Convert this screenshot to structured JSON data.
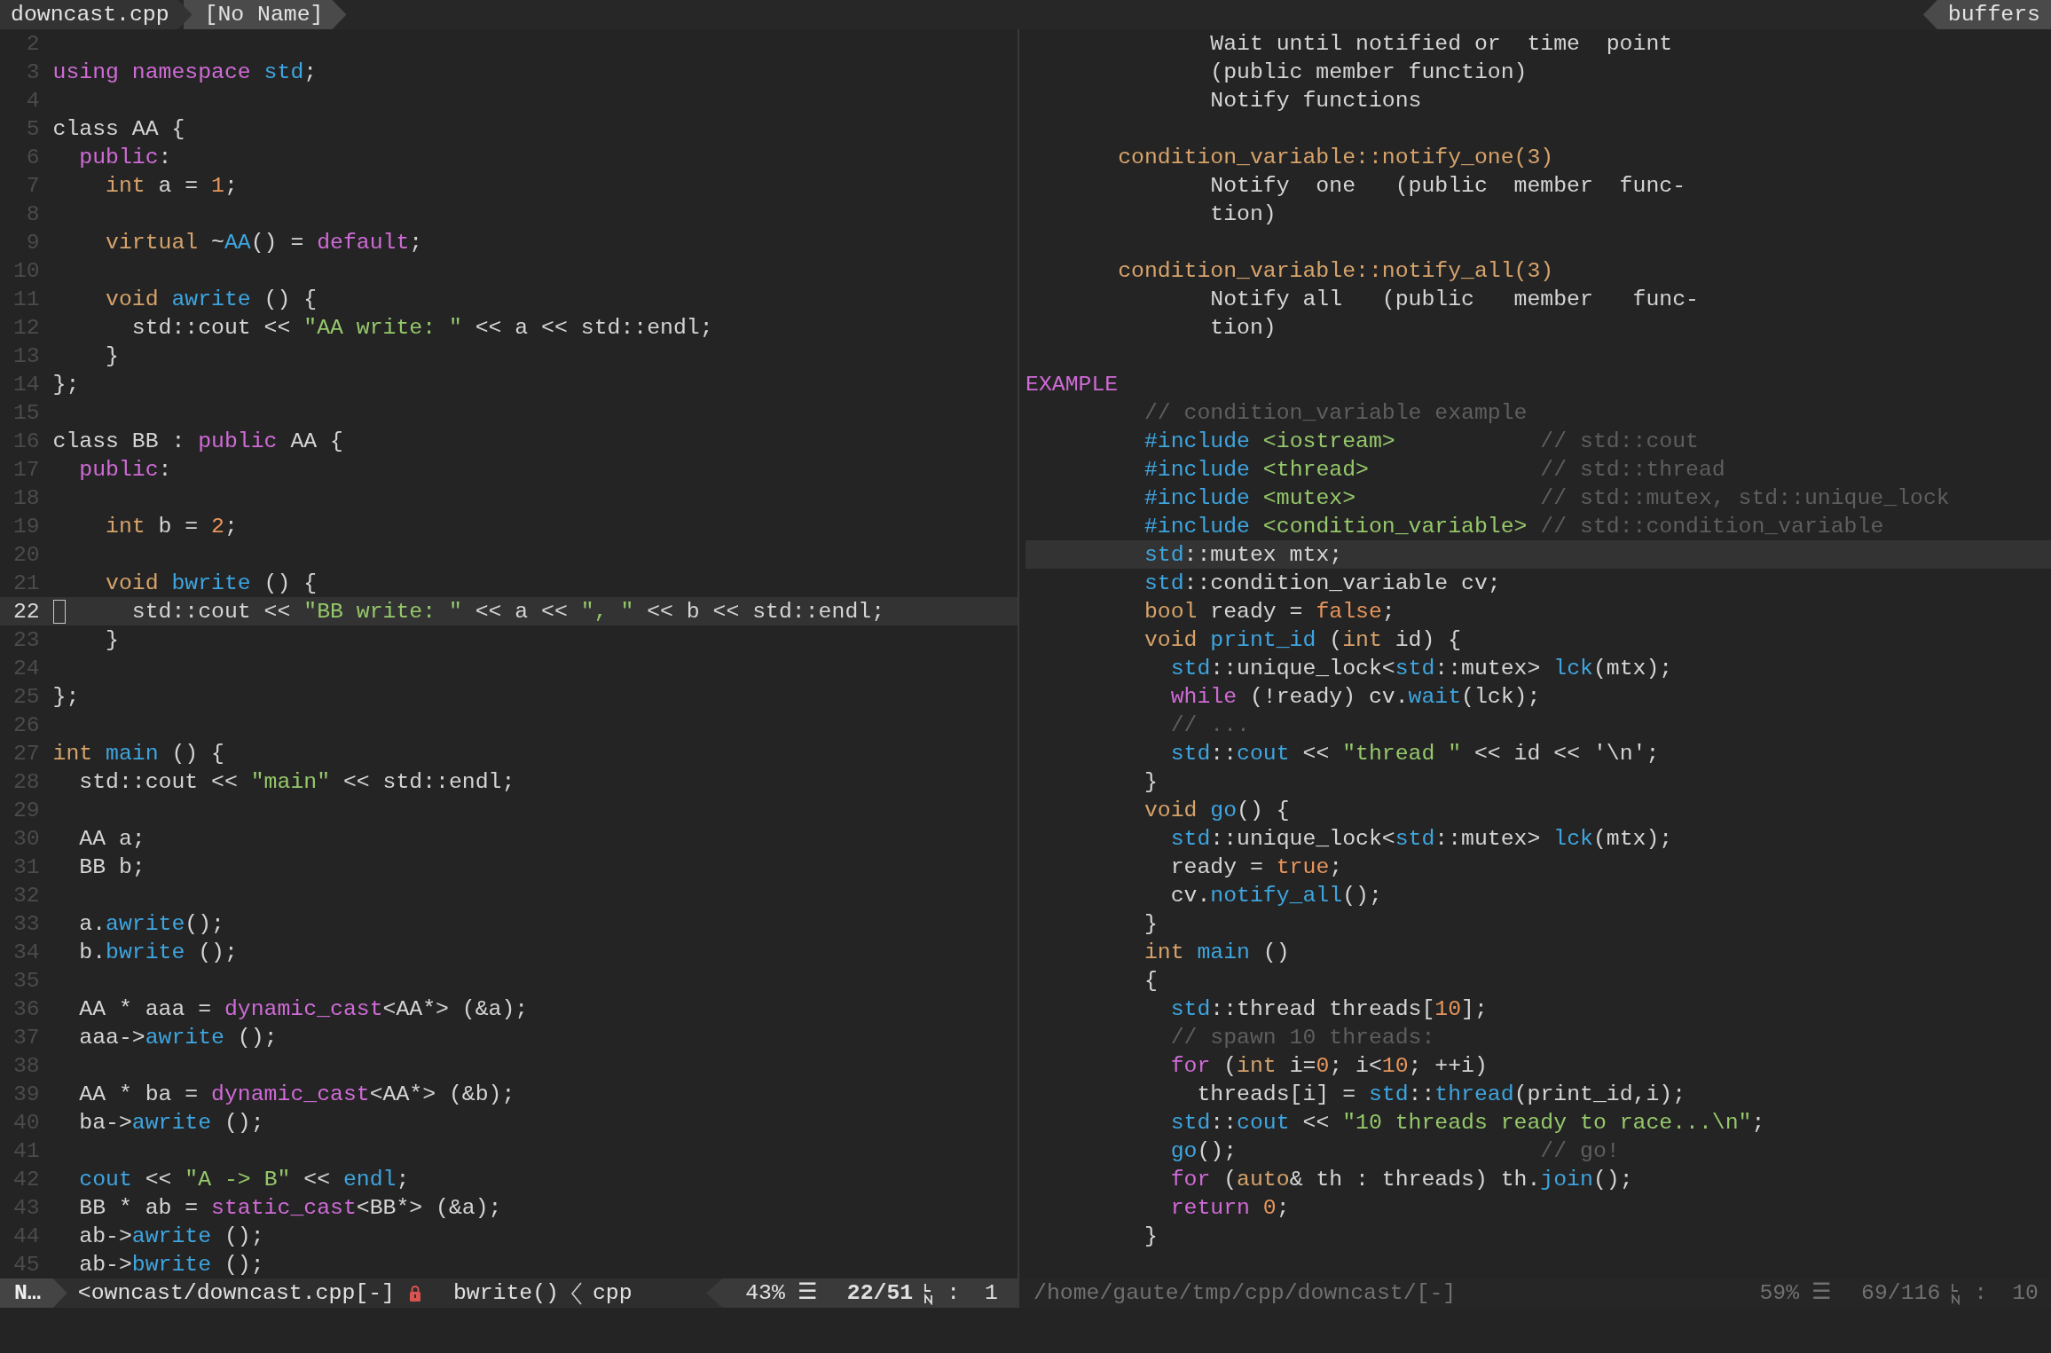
{
  "tabline": {
    "tabs": [
      {
        "label": "downcast.cpp",
        "selected": true
      },
      {
        "label": "[No Name]",
        "selected": false
      }
    ],
    "buffers_label": "buffers"
  },
  "left_window": {
    "active": true,
    "lines": [
      {
        "number": "2",
        "current": false
      },
      {
        "number": "3",
        "current": false,
        "segments": [
          {
            "text": "using namespace",
            "kind": "keyword"
          },
          {
            "text": " std",
            "kind": "function"
          },
          {
            "text": ";",
            "kind": "plain"
          }
        ]
      },
      {
        "number": "4",
        "current": false
      },
      {
        "number": "5",
        "current": false,
        "segments": [
          {
            "text": "class AA {",
            "kind": "plain"
          }
        ]
      },
      {
        "number": "6",
        "current": false,
        "segments": [
          {
            "text": "  public",
            "kind": "keyword"
          },
          {
            "text": ":",
            "kind": "plain"
          }
        ]
      },
      {
        "number": "7",
        "current": false,
        "segments": [
          {
            "text": "    int",
            "kind": "type"
          },
          {
            "text": " a = ",
            "kind": "plain"
          },
          {
            "text": "1",
            "kind": "number"
          },
          {
            "text": ";",
            "kind": "plain"
          }
        ]
      },
      {
        "number": "8",
        "current": false
      },
      {
        "number": "9",
        "current": false,
        "segments": [
          {
            "text": "    virtual",
            "kind": "type"
          },
          {
            "text": " ~",
            "kind": "plain"
          },
          {
            "text": "AA",
            "kind": "function"
          },
          {
            "text": "() = ",
            "kind": "plain"
          },
          {
            "text": "default",
            "kind": "keyword"
          },
          {
            "text": ";",
            "kind": "plain"
          }
        ]
      },
      {
        "number": "10",
        "current": false
      },
      {
        "number": "11",
        "current": false,
        "segments": [
          {
            "text": "    void",
            "kind": "type"
          },
          {
            "text": " awrite",
            "kind": "function"
          },
          {
            "text": " () {",
            "kind": "plain"
          }
        ]
      },
      {
        "number": "12",
        "current": false,
        "segments": [
          {
            "text": "      std::cout << ",
            "kind": "plain"
          },
          {
            "text": "\"AA write: \"",
            "kind": "string"
          },
          {
            "text": " << a << std::endl;",
            "kind": "plain"
          }
        ]
      },
      {
        "number": "13",
        "current": false,
        "segments": [
          {
            "text": "    }",
            "kind": "plain"
          }
        ]
      },
      {
        "number": "14",
        "current": false,
        "segments": [
          {
            "text": "};",
            "kind": "plain"
          }
        ]
      },
      {
        "number": "15",
        "current": false
      },
      {
        "number": "16",
        "current": false,
        "segments": [
          {
            "text": "class BB : ",
            "kind": "plain"
          },
          {
            "text": "public",
            "kind": "keyword"
          },
          {
            "text": " AA {",
            "kind": "plain"
          }
        ]
      },
      {
        "number": "17",
        "current": false,
        "segments": [
          {
            "text": "  public",
            "kind": "keyword"
          },
          {
            "text": ":",
            "kind": "plain"
          }
        ]
      },
      {
        "number": "18",
        "current": false
      },
      {
        "number": "19",
        "current": false,
        "segments": [
          {
            "text": "    int",
            "kind": "type"
          },
          {
            "text": " b = ",
            "kind": "plain"
          },
          {
            "text": "2",
            "kind": "number"
          },
          {
            "text": ";",
            "kind": "plain"
          }
        ]
      },
      {
        "number": "20",
        "current": false
      },
      {
        "number": "21",
        "current": false,
        "segments": [
          {
            "text": "    void",
            "kind": "type"
          },
          {
            "text": " bwrite",
            "kind": "function"
          },
          {
            "text": " () {",
            "kind": "plain"
          }
        ]
      },
      {
        "number": "22",
        "current": true,
        "segments": [
          {
            "text": "      std::cout << ",
            "kind": "plain"
          },
          {
            "text": "\"BB write: \"",
            "kind": "string"
          },
          {
            "text": " << a << ",
            "kind": "plain"
          },
          {
            "text": "\", \"",
            "kind": "string"
          },
          {
            "text": " << b << std::endl;",
            "kind": "plain"
          }
        ]
      },
      {
        "number": "23",
        "current": false,
        "segments": [
          {
            "text": "    }",
            "kind": "plain"
          }
        ]
      },
      {
        "number": "24",
        "current": false
      },
      {
        "number": "25",
        "current": false,
        "segments": [
          {
            "text": "};",
            "kind": "plain"
          }
        ]
      },
      {
        "number": "26",
        "current": false
      },
      {
        "number": "27",
        "current": false,
        "segments": [
          {
            "text": "int",
            "kind": "type"
          },
          {
            "text": " main",
            "kind": "function"
          },
          {
            "text": " () {",
            "kind": "plain"
          }
        ]
      },
      {
        "number": "28",
        "current": false,
        "segments": [
          {
            "text": "  std::cout << ",
            "kind": "plain"
          },
          {
            "text": "\"main\"",
            "kind": "string"
          },
          {
            "text": " << std::endl;",
            "kind": "plain"
          }
        ]
      },
      {
        "number": "29",
        "current": false
      },
      {
        "number": "30",
        "current": false,
        "segments": [
          {
            "text": "  AA a;",
            "kind": "plain"
          }
        ]
      },
      {
        "number": "31",
        "current": false,
        "segments": [
          {
            "text": "  BB b;",
            "kind": "plain"
          }
        ]
      },
      {
        "number": "32",
        "current": false
      },
      {
        "number": "33",
        "current": false,
        "segments": [
          {
            "text": "  a.",
            "kind": "plain"
          },
          {
            "text": "awrite",
            "kind": "function"
          },
          {
            "text": "();",
            "kind": "plain"
          }
        ]
      },
      {
        "number": "34",
        "current": false,
        "segments": [
          {
            "text": "  b.",
            "kind": "plain"
          },
          {
            "text": "bwrite",
            "kind": "function"
          },
          {
            "text": " ();",
            "kind": "plain"
          }
        ]
      },
      {
        "number": "35",
        "current": false
      },
      {
        "number": "36",
        "current": false,
        "segments": [
          {
            "text": "  AA * aaa = ",
            "kind": "plain"
          },
          {
            "text": "dynamic_cast",
            "kind": "keyword"
          },
          {
            "text": "<AA*> (&a);",
            "kind": "plain"
          }
        ]
      },
      {
        "number": "37",
        "current": false,
        "segments": [
          {
            "text": "  aaa->",
            "kind": "plain"
          },
          {
            "text": "awrite",
            "kind": "function"
          },
          {
            "text": " ();",
            "kind": "plain"
          }
        ]
      },
      {
        "number": "38",
        "current": false
      },
      {
        "number": "39",
        "current": false,
        "segments": [
          {
            "text": "  AA * ba = ",
            "kind": "plain"
          },
          {
            "text": "dynamic_cast",
            "kind": "keyword"
          },
          {
            "text": "<AA*> (&b);",
            "kind": "plain"
          }
        ]
      },
      {
        "number": "40",
        "current": false,
        "segments": [
          {
            "text": "  ba->",
            "kind": "plain"
          },
          {
            "text": "awrite",
            "kind": "function"
          },
          {
            "text": " ();",
            "kind": "plain"
          }
        ]
      },
      {
        "number": "41",
        "current": false
      },
      {
        "number": "42",
        "current": false,
        "segments": [
          {
            "text": "  cout",
            "kind": "function"
          },
          {
            "text": " << ",
            "kind": "plain"
          },
          {
            "text": "\"A -> B\"",
            "kind": "string"
          },
          {
            "text": " << ",
            "kind": "plain"
          },
          {
            "text": "endl",
            "kind": "function"
          },
          {
            "text": ";",
            "kind": "plain"
          }
        ]
      },
      {
        "number": "43",
        "current": false,
        "segments": [
          {
            "text": "  BB * ab = ",
            "kind": "plain"
          },
          {
            "text": "static_cast",
            "kind": "keyword"
          },
          {
            "text": "<BB*> (&a);",
            "kind": "plain"
          }
        ]
      },
      {
        "number": "44",
        "current": false,
        "segments": [
          {
            "text": "  ab->",
            "kind": "plain"
          },
          {
            "text": "awrite",
            "kind": "function"
          },
          {
            "text": " ();",
            "kind": "plain"
          }
        ]
      },
      {
        "number": "45",
        "current": false,
        "segments": [
          {
            "text": "  ab->",
            "kind": "plain"
          },
          {
            "text": "bwrite",
            "kind": "function"
          },
          {
            "text": " ();",
            "kind": "plain"
          }
        ]
      }
    ],
    "status": {
      "mode": "N…",
      "file": "<owncast/downcast.cpp[-]",
      "readonly": true,
      "function": "bwrite()",
      "filetype": "cpp",
      "percent": "43%",
      "glyph": "☰",
      "position": "22/51",
      "separator": ":",
      "column": "1"
    }
  },
  "right_window": {
    "active": false,
    "lines": [
      {
        "current": false,
        "segments": [
          {
            "text": "              Wait until notified or  time  point",
            "kind": "plain"
          }
        ]
      },
      {
        "current": false,
        "segments": [
          {
            "text": "              (public member function)",
            "kind": "plain"
          }
        ]
      },
      {
        "current": false,
        "segments": [
          {
            "text": "              Notify functions",
            "kind": "plain"
          }
        ]
      },
      {
        "current": false
      },
      {
        "current": false,
        "segments": [
          {
            "text": "       condition_variable::notify_one(3)",
            "kind": "type"
          }
        ]
      },
      {
        "current": false,
        "segments": [
          {
            "text": "              Notify  one   (public  member  func-",
            "kind": "plain"
          }
        ]
      },
      {
        "current": false,
        "segments": [
          {
            "text": "              tion)",
            "kind": "plain"
          }
        ]
      },
      {
        "current": false
      },
      {
        "current": false,
        "segments": [
          {
            "text": "       condition_variable::notify_all(3)",
            "kind": "type"
          }
        ]
      },
      {
        "current": false,
        "segments": [
          {
            "text": "              Notify all   (public   member   func-",
            "kind": "plain"
          }
        ]
      },
      {
        "current": false,
        "segments": [
          {
            "text": "              tion)",
            "kind": "plain"
          }
        ]
      },
      {
        "current": false
      },
      {
        "current": false,
        "segments": [
          {
            "text": "EXAMPLE",
            "kind": "keyword"
          }
        ]
      },
      {
        "current": false,
        "segments": [
          {
            "text": "         // condition_variable example",
            "kind": "comment"
          }
        ]
      },
      {
        "current": false,
        "segments": [
          {
            "text": "         #include",
            "kind": "function"
          },
          {
            "text": " <iostream>",
            "kind": "string"
          },
          {
            "text": "           // std::cout",
            "kind": "comment"
          }
        ]
      },
      {
        "current": false,
        "segments": [
          {
            "text": "         #include",
            "kind": "function"
          },
          {
            "text": " <thread>",
            "kind": "string"
          },
          {
            "text": "             // std::thread",
            "kind": "comment"
          }
        ]
      },
      {
        "current": false,
        "segments": [
          {
            "text": "         #include",
            "kind": "function"
          },
          {
            "text": " <mutex>",
            "kind": "string"
          },
          {
            "text": "              // std::mutex, std::unique_lock",
            "kind": "comment"
          }
        ]
      },
      {
        "current": false,
        "segments": [
          {
            "text": "         #include",
            "kind": "function"
          },
          {
            "text": " <condition_variable>",
            "kind": "string"
          },
          {
            "text": " // std::condition_variable",
            "kind": "comment"
          }
        ]
      },
      {
        "current": true,
        "segments": [
          {
            "text": "         std",
            "kind": "function"
          },
          {
            "text": "::mutex mtx;",
            "kind": "plain"
          }
        ]
      },
      {
        "current": false,
        "segments": [
          {
            "text": "         std",
            "kind": "function"
          },
          {
            "text": "::condition_variable cv;",
            "kind": "plain"
          }
        ]
      },
      {
        "current": false,
        "segments": [
          {
            "text": "         bool",
            "kind": "type"
          },
          {
            "text": " ready = ",
            "kind": "plain"
          },
          {
            "text": "false",
            "kind": "number"
          },
          {
            "text": ";",
            "kind": "plain"
          }
        ]
      },
      {
        "current": false,
        "segments": [
          {
            "text": "         void",
            "kind": "type"
          },
          {
            "text": " print_id",
            "kind": "function"
          },
          {
            "text": " (",
            "kind": "plain"
          },
          {
            "text": "int",
            "kind": "type"
          },
          {
            "text": " id) {",
            "kind": "plain"
          }
        ]
      },
      {
        "current": false,
        "segments": [
          {
            "text": "           std",
            "kind": "function"
          },
          {
            "text": "::unique_lock<",
            "kind": "plain"
          },
          {
            "text": "std",
            "kind": "function"
          },
          {
            "text": "::mutex> ",
            "kind": "plain"
          },
          {
            "text": "lck",
            "kind": "function"
          },
          {
            "text": "(mtx);",
            "kind": "plain"
          }
        ]
      },
      {
        "current": false,
        "segments": [
          {
            "text": "           while",
            "kind": "keyword"
          },
          {
            "text": " (!ready) cv.",
            "kind": "plain"
          },
          {
            "text": "wait",
            "kind": "function"
          },
          {
            "text": "(lck);",
            "kind": "plain"
          }
        ]
      },
      {
        "current": false,
        "segments": [
          {
            "text": "           // ...",
            "kind": "comment"
          }
        ]
      },
      {
        "current": false,
        "segments": [
          {
            "text": "           std",
            "kind": "function"
          },
          {
            "text": "::",
            "kind": "plain"
          },
          {
            "text": "cout",
            "kind": "function"
          },
          {
            "text": " << ",
            "kind": "plain"
          },
          {
            "text": "\"thread \"",
            "kind": "string"
          },
          {
            "text": " << id << '\\n';",
            "kind": "plain"
          }
        ]
      },
      {
        "current": false,
        "segments": [
          {
            "text": "         }",
            "kind": "plain"
          }
        ]
      },
      {
        "current": false,
        "segments": [
          {
            "text": "         void",
            "kind": "type"
          },
          {
            "text": " go",
            "kind": "function"
          },
          {
            "text": "() {",
            "kind": "plain"
          }
        ]
      },
      {
        "current": false,
        "segments": [
          {
            "text": "           std",
            "kind": "function"
          },
          {
            "text": "::unique_lock<",
            "kind": "plain"
          },
          {
            "text": "std",
            "kind": "function"
          },
          {
            "text": "::mutex> ",
            "kind": "plain"
          },
          {
            "text": "lck",
            "kind": "function"
          },
          {
            "text": "(mtx);",
            "kind": "plain"
          }
        ]
      },
      {
        "current": false,
        "segments": [
          {
            "text": "           ready = ",
            "kind": "plain"
          },
          {
            "text": "true",
            "kind": "number"
          },
          {
            "text": ";",
            "kind": "plain"
          }
        ]
      },
      {
        "current": false,
        "segments": [
          {
            "text": "           cv.",
            "kind": "plain"
          },
          {
            "text": "notify_all",
            "kind": "function"
          },
          {
            "text": "();",
            "kind": "plain"
          }
        ]
      },
      {
        "current": false,
        "segments": [
          {
            "text": "         }",
            "kind": "plain"
          }
        ]
      },
      {
        "current": false,
        "segments": [
          {
            "text": "         int",
            "kind": "type"
          },
          {
            "text": " main",
            "kind": "function"
          },
          {
            "text": " ()",
            "kind": "plain"
          }
        ]
      },
      {
        "current": false,
        "segments": [
          {
            "text": "         {",
            "kind": "plain"
          }
        ]
      },
      {
        "current": false,
        "segments": [
          {
            "text": "           std",
            "kind": "function"
          },
          {
            "text": "::thread threads[",
            "kind": "plain"
          },
          {
            "text": "10",
            "kind": "number"
          },
          {
            "text": "];",
            "kind": "plain"
          }
        ]
      },
      {
        "current": false,
        "segments": [
          {
            "text": "           // spawn 10 threads:",
            "kind": "comment"
          }
        ]
      },
      {
        "current": false,
        "segments": [
          {
            "text": "           for",
            "kind": "keyword"
          },
          {
            "text": " (",
            "kind": "plain"
          },
          {
            "text": "int",
            "kind": "type"
          },
          {
            "text": " i=",
            "kind": "plain"
          },
          {
            "text": "0",
            "kind": "number"
          },
          {
            "text": "; i<",
            "kind": "plain"
          },
          {
            "text": "10",
            "kind": "number"
          },
          {
            "text": "; ++i)",
            "kind": "plain"
          }
        ]
      },
      {
        "current": false,
        "segments": [
          {
            "text": "             threads[i] = ",
            "kind": "plain"
          },
          {
            "text": "std",
            "kind": "function"
          },
          {
            "text": "::",
            "kind": "plain"
          },
          {
            "text": "thread",
            "kind": "function"
          },
          {
            "text": "(print_id,i);",
            "kind": "plain"
          }
        ]
      },
      {
        "current": false,
        "segments": [
          {
            "text": "           std",
            "kind": "function"
          },
          {
            "text": "::",
            "kind": "plain"
          },
          {
            "text": "cout",
            "kind": "function"
          },
          {
            "text": " << ",
            "kind": "plain"
          },
          {
            "text": "\"10 threads ready to race...\\n\"",
            "kind": "string"
          },
          {
            "text": ";",
            "kind": "plain"
          }
        ]
      },
      {
        "current": false,
        "segments": [
          {
            "text": "           go",
            "kind": "function"
          },
          {
            "text": "();                       ",
            "kind": "plain"
          },
          {
            "text": "// go!",
            "kind": "comment"
          }
        ]
      },
      {
        "current": false,
        "segments": [
          {
            "text": "           for",
            "kind": "keyword"
          },
          {
            "text": " (",
            "kind": "plain"
          },
          {
            "text": "auto",
            "kind": "type"
          },
          {
            "text": "& th : threads) th.",
            "kind": "plain"
          },
          {
            "text": "join",
            "kind": "function"
          },
          {
            "text": "();",
            "kind": "plain"
          }
        ]
      },
      {
        "current": false,
        "segments": [
          {
            "text": "           return",
            "kind": "keyword"
          },
          {
            "text": " 0",
            "kind": "number"
          },
          {
            "text": ";",
            "kind": "plain"
          }
        ]
      },
      {
        "current": false,
        "segments": [
          {
            "text": "         }",
            "kind": "plain"
          }
        ]
      },
      {
        "current": false
      }
    ],
    "status": {
      "file": "/home/gaute/tmp/cpp/downcast/[-]",
      "readonly": false,
      "percent": "59%",
      "glyph": "☰",
      "position": "69/116",
      "separator": ":",
      "column": "10"
    }
  }
}
